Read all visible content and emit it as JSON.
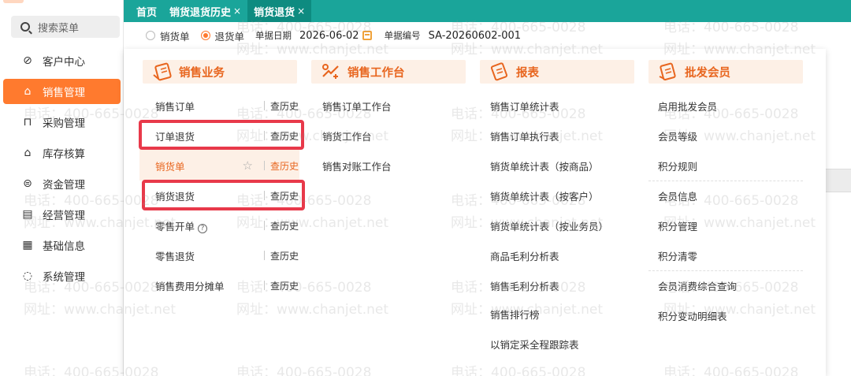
{
  "sidebar": {
    "search_placeholder": "搜索菜单",
    "items": [
      {
        "label": "客户中心",
        "icon": "compass-icon"
      },
      {
        "label": "销售管理",
        "icon": "shop-icon",
        "active": true
      },
      {
        "label": "采购管理",
        "icon": "bag-icon"
      },
      {
        "label": "库存核算",
        "icon": "warehouse-icon"
      },
      {
        "label": "资金管理",
        "icon": "money-icon"
      },
      {
        "label": "经营管理",
        "icon": "clipboard-icon"
      },
      {
        "label": "基础信息",
        "icon": "card-icon"
      },
      {
        "label": "系统管理",
        "icon": "settings-ring-icon"
      }
    ]
  },
  "header": {
    "tabs": [
      {
        "label": "首页"
      },
      {
        "label": "销货退货历史",
        "close": "×"
      },
      {
        "label": "销货退货",
        "close": "×",
        "active": true
      }
    ]
  },
  "form": {
    "radio_sale": "销货单",
    "radio_return": "退货单",
    "date_label": "单据日期",
    "date_value": "2026-06-02",
    "code_label": "单据编号",
    "code_value": "SA-20260602-001"
  },
  "menu": {
    "columns": [
      {
        "title": "销售业务",
        "items": [
          {
            "label": "销售订单",
            "hist": "查历史"
          },
          {
            "label": "订单退货",
            "hist": "查历史"
          },
          {
            "label": "销货单",
            "hist": "查历史"
          },
          {
            "label": "销货退货",
            "hist": "查历史"
          },
          {
            "label": "零售开单",
            "hist": "查历史",
            "help": "?"
          },
          {
            "label": "零售退货",
            "hist": "查历史"
          },
          {
            "label": "销售费用分摊单",
            "hist": "查历史"
          }
        ]
      },
      {
        "title": "销售工作台",
        "items": [
          {
            "label": "销售订单工作台"
          },
          {
            "label": "销货工作台"
          },
          {
            "label": "销售对账工作台"
          }
        ]
      },
      {
        "title": "报表",
        "items": [
          {
            "label": "销售订单统计表"
          },
          {
            "label": "销售订单执行表"
          },
          {
            "label": "销货单统计表（按商品）"
          },
          {
            "label": "销货单统计表（按客户）"
          },
          {
            "label": "销货单统计表（按业务员）"
          },
          {
            "label": "商品毛利分析表"
          },
          {
            "label": "销售毛利分析表"
          },
          {
            "label": "销售排行榜"
          },
          {
            "label": "以销定采全程跟踪表"
          }
        ]
      },
      {
        "title": "批发会员",
        "items": [
          {
            "label": "启用批发会员"
          },
          {
            "label": "会员等级"
          },
          {
            "label": "积分规则"
          },
          {
            "label": "会员信息"
          },
          {
            "label": "积分管理"
          },
          {
            "label": "积分清零"
          },
          {
            "label": "会员消费综合查询"
          },
          {
            "label": "积分变动明细表"
          }
        ]
      }
    ]
  },
  "watermark": {
    "phone": "电话：400-665-0028",
    "site": "网址：www.chanjet.net"
  },
  "colors": {
    "accent": "#ff7a2e",
    "header": "#1aa59a",
    "highlight_box": "#e8394a"
  }
}
